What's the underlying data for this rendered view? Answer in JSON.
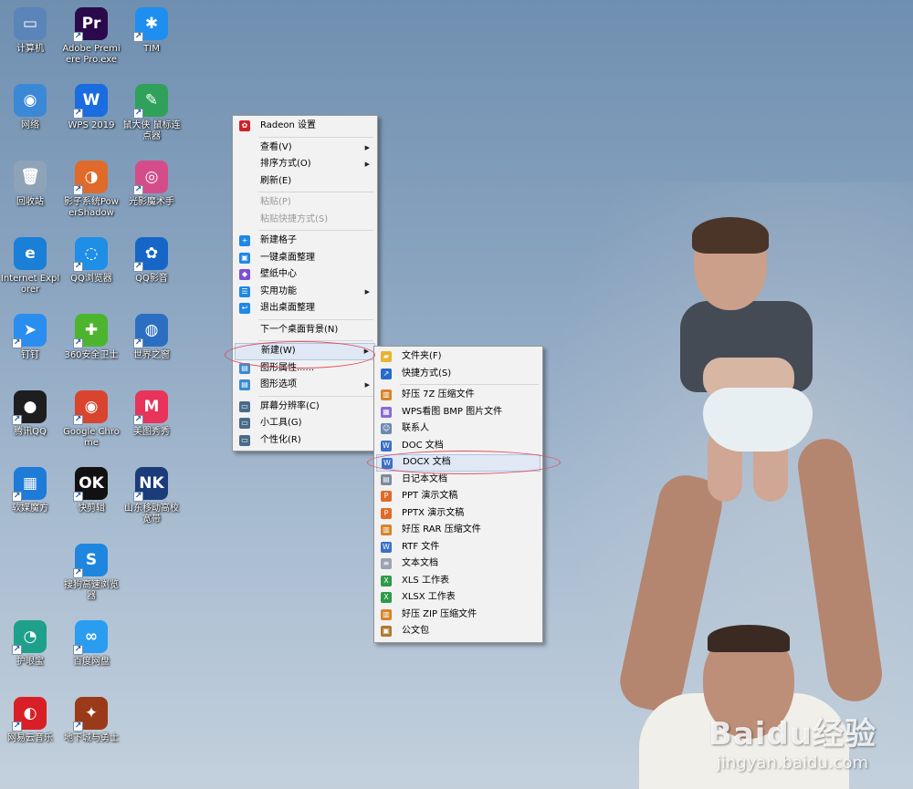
{
  "desktop": {
    "icons": [
      {
        "label": "计算机",
        "icon": "computer-icon",
        "color": "#5b84b8",
        "glyph": "▭",
        "shortcut": false
      },
      {
        "label": "Adobe Premiere Pro.exe",
        "icon": "premiere-icon",
        "color": "#2a0a4a",
        "glyph": "Pr",
        "shortcut": true
      },
      {
        "label": "TIM",
        "icon": "tim-icon",
        "color": "#1f8ef1",
        "glyph": "✱",
        "shortcut": true
      },
      {
        "label": "网络",
        "icon": "network-icon",
        "color": "#3b88d6",
        "glyph": "◉",
        "shortcut": false
      },
      {
        "label": "WPS 2019",
        "icon": "wps-icon",
        "color": "#1a6ce0",
        "glyph": "W",
        "shortcut": true
      },
      {
        "label": "鼠大侠 鼠标连点器",
        "icon": "mouse-clicker-icon",
        "color": "#2fa15a",
        "glyph": "✎",
        "shortcut": true
      },
      {
        "label": "回收站",
        "icon": "recycle-bin-icon",
        "color": "#8fa3b8",
        "glyph": "🗑",
        "shortcut": false
      },
      {
        "label": "影子系统PowerShadow",
        "icon": "powershadow-icon",
        "color": "#e06a2a",
        "glyph": "◑",
        "shortcut": true
      },
      {
        "label": "光影魔术手",
        "icon": "nEO-imaging-icon",
        "color": "#d44d8a",
        "glyph": "◎",
        "shortcut": true
      },
      {
        "label": "Internet Explorer",
        "icon": "internet-explorer-icon",
        "color": "#1a7fd6",
        "glyph": "e",
        "shortcut": false
      },
      {
        "label": "QQ浏览器",
        "icon": "qq-browser-icon",
        "color": "#1e8ee6",
        "glyph": "◌",
        "shortcut": true
      },
      {
        "label": "QQ影音",
        "icon": "qq-player-icon",
        "color": "#1666c8",
        "glyph": "✿",
        "shortcut": true
      },
      {
        "label": "钉钉",
        "icon": "dingtalk-icon",
        "color": "#2a8ef0",
        "glyph": "➤",
        "shortcut": true
      },
      {
        "label": "360安全卫士",
        "icon": "360-security-icon",
        "color": "#4db52d",
        "glyph": "✚",
        "shortcut": true
      },
      {
        "label": "世界之窗",
        "icon": "theworld-browser-icon",
        "color": "#2c6fc2",
        "glyph": "◍",
        "shortcut": true
      },
      {
        "label": "腾讯QQ",
        "icon": "qq-icon",
        "color": "#1e1e1e",
        "glyph": "●",
        "shortcut": true
      },
      {
        "label": "Google Chrome",
        "icon": "chrome-icon",
        "color": "#d9442f",
        "glyph": "◉",
        "shortcut": true
      },
      {
        "label": "美图秀秀",
        "icon": "meitu-icon",
        "color": "#e8335a",
        "glyph": "M",
        "shortcut": true
      },
      {
        "label": "软媒魔方",
        "icon": "ruanmei-mofang-icon",
        "color": "#1f7bd8",
        "glyph": "▦",
        "shortcut": true
      },
      {
        "label": "快剪辑",
        "icon": "kuaijianji-icon",
        "color": "#111111",
        "glyph": "OK",
        "shortcut": true
      },
      {
        "label": "山东移动高校宽带",
        "icon": "sdmobile-broadband-icon",
        "color": "#1a3c7a",
        "glyph": "NK",
        "shortcut": true
      },
      {
        "label": "搜狗高速浏览器",
        "icon": "sogou-browser-icon",
        "color": "#1f86e0",
        "glyph": "S",
        "shortcut": true
      },
      {
        "label": "护眼宝",
        "icon": "eye-protection-icon",
        "color": "#1fa08a",
        "glyph": "◔",
        "shortcut": true
      },
      {
        "label": "百度网盘",
        "icon": "baidu-netdisk-icon",
        "color": "#2a9df0",
        "glyph": "∞",
        "shortcut": true
      },
      {
        "label": "网易云音乐",
        "icon": "netease-music-icon",
        "color": "#d81f26",
        "glyph": "◐",
        "shortcut": true
      },
      {
        "label": "地下城与勇士",
        "icon": "dnf-game-icon",
        "color": "#9a3a18",
        "glyph": "✦",
        "shortcut": true
      }
    ]
  },
  "context_menu": {
    "items": [
      {
        "type": "item",
        "label": "Radeon 设置",
        "icon": "radeon-icon",
        "icon_color": "#d0202a",
        "glyph": "✿",
        "disabled": false,
        "submenu": false
      },
      {
        "type": "sep"
      },
      {
        "type": "item",
        "label": "查看(V)",
        "icon": "",
        "disabled": false,
        "submenu": true
      },
      {
        "type": "item",
        "label": "排序方式(O)",
        "icon": "",
        "disabled": false,
        "submenu": true
      },
      {
        "type": "item",
        "label": "刷新(E)",
        "icon": "",
        "disabled": false,
        "submenu": false
      },
      {
        "type": "sep"
      },
      {
        "type": "item",
        "label": "粘贴(P)",
        "icon": "",
        "disabled": true,
        "submenu": false
      },
      {
        "type": "item",
        "label": "粘贴快捷方式(S)",
        "icon": "",
        "disabled": true,
        "submenu": false
      },
      {
        "type": "sep"
      },
      {
        "type": "item",
        "label": "新建格子",
        "icon": "new-grid-icon",
        "icon_color": "#1e88e5",
        "glyph": "+",
        "disabled": false,
        "submenu": false
      },
      {
        "type": "item",
        "label": "一键桌面整理",
        "icon": "desktop-organize-icon",
        "icon_color": "#1e88e5",
        "glyph": "▣",
        "disabled": false,
        "submenu": false
      },
      {
        "type": "item",
        "label": "壁纸中心",
        "icon": "wallpaper-center-icon",
        "icon_color": "#7b4fd6",
        "glyph": "◆",
        "disabled": false,
        "submenu": false
      },
      {
        "type": "item",
        "label": "实用功能",
        "icon": "utilities-icon",
        "icon_color": "#1e88e5",
        "glyph": "☰",
        "disabled": false,
        "submenu": true
      },
      {
        "type": "item",
        "label": "退出桌面整理",
        "icon": "exit-organize-icon",
        "icon_color": "#1e88e5",
        "glyph": "↩",
        "disabled": false,
        "submenu": false
      },
      {
        "type": "sep"
      },
      {
        "type": "item",
        "label": "下一个桌面背景(N)",
        "icon": "",
        "disabled": false,
        "submenu": false
      },
      {
        "type": "sep"
      },
      {
        "type": "item",
        "label": "新建(W)",
        "icon": "",
        "disabled": false,
        "submenu": true,
        "highlight": true
      },
      {
        "type": "item",
        "label": "图形属性......",
        "icon": "graphics-properties-icon",
        "icon_color": "#3a8bd0",
        "glyph": "▤",
        "disabled": false,
        "submenu": false
      },
      {
        "type": "item",
        "label": "图形选项",
        "icon": "graphics-options-icon",
        "icon_color": "#3a8bd0",
        "glyph": "▤",
        "disabled": false,
        "submenu": true
      },
      {
        "type": "sep"
      },
      {
        "type": "item",
        "label": "屏幕分辨率(C)",
        "icon": "screen-resolution-icon",
        "icon_color": "#4a6a8a",
        "glyph": "▭",
        "disabled": false,
        "submenu": false
      },
      {
        "type": "item",
        "label": "小工具(G)",
        "icon": "gadgets-icon",
        "icon_color": "#4a6a8a",
        "glyph": "▭",
        "disabled": false,
        "submenu": false
      },
      {
        "type": "item",
        "label": "个性化(R)",
        "icon": "personalize-icon",
        "icon_color": "#4a6a8a",
        "glyph": "▭",
        "disabled": false,
        "submenu": false
      }
    ]
  },
  "new_submenu": {
    "items": [
      {
        "type": "item",
        "label": "文件夹(F)",
        "icon": "folder-icon",
        "icon_color": "#e8b530",
        "glyph": "▰"
      },
      {
        "type": "item",
        "label": "快捷方式(S)",
        "icon": "shortcut-icon",
        "icon_color": "#2a6ac8",
        "glyph": "↗"
      },
      {
        "type": "sep"
      },
      {
        "type": "item",
        "label": "好压 7Z 压缩文件",
        "icon": "haozip-7z-icon",
        "icon_color": "#d9832a",
        "glyph": "▥"
      },
      {
        "type": "item",
        "label": "WPS看图 BMP 图片文件",
        "icon": "wps-bmp-icon",
        "icon_color": "#8a6ad0",
        "glyph": "▦"
      },
      {
        "type": "item",
        "label": "联系人",
        "icon": "contact-icon",
        "icon_color": "#6a8ab0",
        "glyph": "☺"
      },
      {
        "type": "item",
        "label": "DOC 文档",
        "icon": "doc-icon",
        "icon_color": "#3a70c8",
        "glyph": "W"
      },
      {
        "type": "item",
        "label": "DOCX 文档",
        "icon": "docx-icon",
        "icon_color": "#3a70c8",
        "glyph": "W",
        "highlight": true
      },
      {
        "type": "item",
        "label": "日记本文档",
        "icon": "journal-icon",
        "icon_color": "#7a8a9a",
        "glyph": "▤"
      },
      {
        "type": "item",
        "label": "PPT 演示文稿",
        "icon": "ppt-icon",
        "icon_color": "#e06a2a",
        "glyph": "P"
      },
      {
        "type": "item",
        "label": "PPTX 演示文稿",
        "icon": "pptx-icon",
        "icon_color": "#e06a2a",
        "glyph": "P"
      },
      {
        "type": "item",
        "label": "好压 RAR 压缩文件",
        "icon": "haozip-rar-icon",
        "icon_color": "#d9832a",
        "glyph": "▥"
      },
      {
        "type": "item",
        "label": "RTF 文件",
        "icon": "rtf-icon",
        "icon_color": "#3a70c8",
        "glyph": "W"
      },
      {
        "type": "item",
        "label": "文本文档",
        "icon": "text-document-icon",
        "icon_color": "#9aa4b0",
        "glyph": "≡"
      },
      {
        "type": "item",
        "label": "XLS 工作表",
        "icon": "xls-icon",
        "icon_color": "#2e9a48",
        "glyph": "X"
      },
      {
        "type": "item",
        "label": "XLSX 工作表",
        "icon": "xlsx-icon",
        "icon_color": "#2e9a48",
        "glyph": "X"
      },
      {
        "type": "item",
        "label": "好压 ZIP 压缩文件",
        "icon": "haozip-zip-icon",
        "icon_color": "#d9832a",
        "glyph": "▥"
      },
      {
        "type": "item",
        "label": "公文包",
        "icon": "briefcase-icon",
        "icon_color": "#b07a30",
        "glyph": "▣"
      }
    ]
  },
  "watermark": {
    "logo": "Baidu经验",
    "url": "jingyan.baidu.com"
  }
}
